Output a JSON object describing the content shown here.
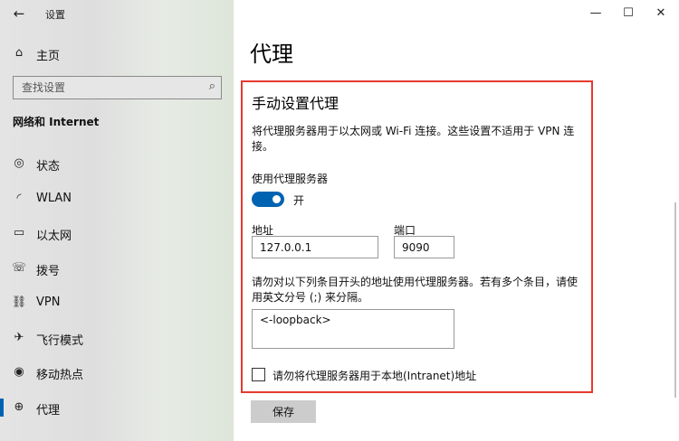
{
  "window": {
    "title": "设置",
    "back_glyph": "←",
    "minimize_glyph": "—",
    "maximize_glyph": "☐",
    "close_glyph": "✕"
  },
  "sidebar": {
    "home": {
      "label": "主页",
      "icon": "home-icon",
      "glyph": "⌂"
    },
    "search": {
      "placeholder": "查找设置",
      "icon_glyph": "⌕"
    },
    "section_header": "网络和 Internet",
    "items": [
      {
        "label": "状态",
        "icon": "status-icon",
        "glyph": "◎"
      },
      {
        "label": "WLAN",
        "icon": "wifi-icon",
        "glyph": "◜"
      },
      {
        "label": "以太网",
        "icon": "ethernet-icon",
        "glyph": "▭"
      },
      {
        "label": "拨号",
        "icon": "dialup-icon",
        "glyph": "☏"
      },
      {
        "label": "VPN",
        "icon": "vpn-icon",
        "glyph": "⛓"
      },
      {
        "label": "飞行模式",
        "icon": "airplane-icon",
        "glyph": "✈"
      },
      {
        "label": "移动热点",
        "icon": "hotspot-icon",
        "glyph": "◉"
      },
      {
        "label": "代理",
        "icon": "globe-icon",
        "glyph": "⊕",
        "active": true
      }
    ]
  },
  "main": {
    "page_title": "代理",
    "manual": {
      "heading": "手动设置代理",
      "description": "将代理服务器用于以太网或 Wi-Fi 连接。这些设置不适用于 VPN 连接。",
      "use_proxy_label": "使用代理服务器",
      "toggle_state": "开",
      "address_label": "地址",
      "address_value": "127.0.0.1",
      "port_label": "端口",
      "port_value": "9090",
      "exceptions_description": "请勿对以下列条目开头的地址使用代理服务器。若有多个条目，请使用英文分号 (;) 来分隔。",
      "exceptions_value": "<-loopback>",
      "bypass_local_label": "请勿将代理服务器用于本地(Intranet)地址"
    },
    "save_label": "保存"
  },
  "colors": {
    "accent": "#0063b1",
    "highlight_border": "#e53a2e",
    "save_button_bg": "#cccccc"
  }
}
